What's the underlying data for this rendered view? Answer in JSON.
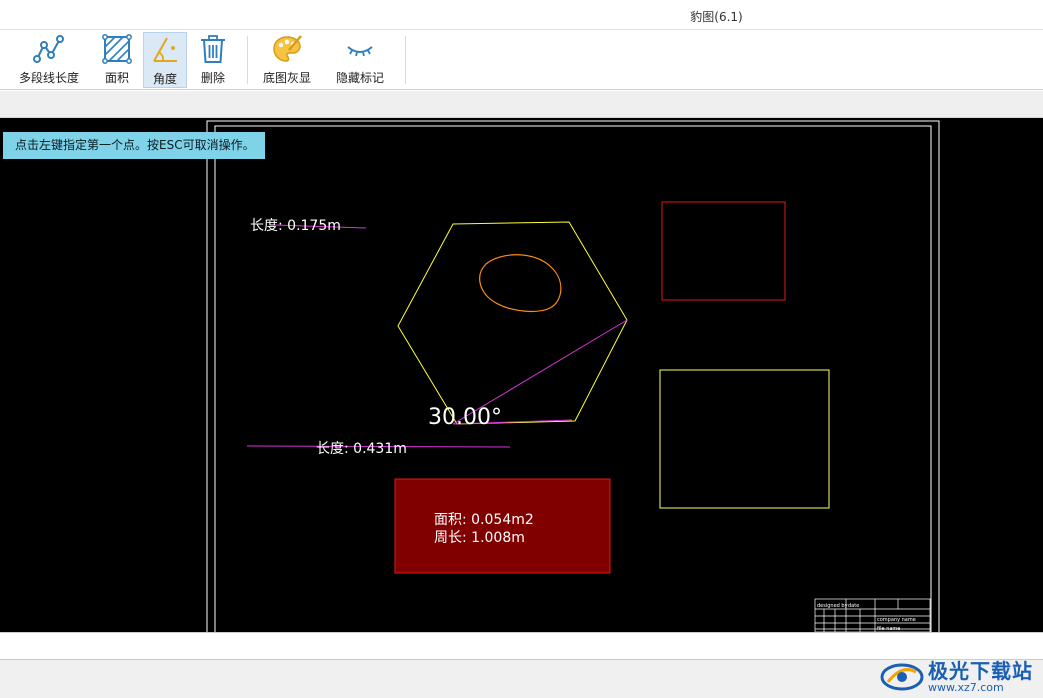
{
  "window": {
    "title": "豹图(6.1)"
  },
  "ribbon": {
    "tools": [
      {
        "label": "多段线长度",
        "icon": "polyline-length-icon"
      },
      {
        "label": "面积",
        "icon": "area-icon"
      },
      {
        "label": "角度",
        "icon": "angle-icon"
      },
      {
        "label": "删除",
        "icon": "trash-icon"
      },
      {
        "label": "底图灰显",
        "icon": "palette-icon"
      },
      {
        "label": "隐藏标记",
        "icon": "eye-closed-icon"
      }
    ],
    "active_tool": "角度"
  },
  "canvas": {
    "hint": "点击左键指定第一个点。按ESC可取消操作。",
    "length_label_1": "长度: 0.175m",
    "length_label_2": "长度: 0.431m",
    "angle_label": "30.00°",
    "area_label": "面积: 0.054m2",
    "perimeter_label": "周长: 1.008m",
    "title_block": {
      "company": "company name",
      "file_name": "file name",
      "designed_by": "designed by",
      "date": "date"
    },
    "colors": {
      "background": "#000000",
      "sheet_border": "#ffffff",
      "hexagon": "#ffff33",
      "blob": "#ff8c1a",
      "measure_line": "#d633d6",
      "red_rect": "#e01818",
      "yellow_rect": "#ffff66",
      "area_fill": "#800000"
    }
  },
  "watermark": {
    "brand": "极光下载站",
    "url": "www.xz7.com"
  }
}
